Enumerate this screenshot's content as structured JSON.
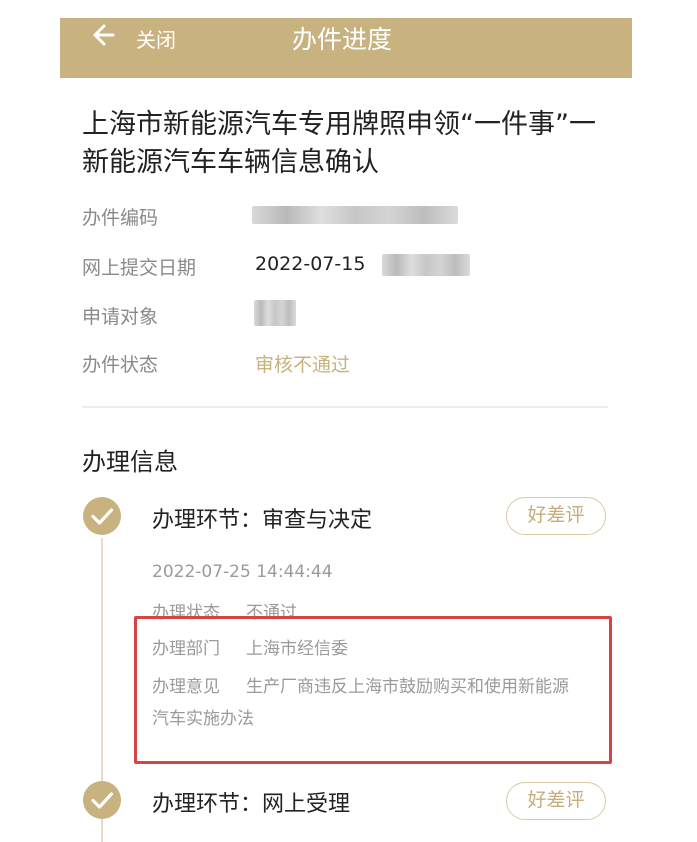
{
  "header": {
    "close_label": "关闭",
    "title": "办件进度"
  },
  "case": {
    "title": "上海市新能源汽车专用牌照申领“一件事”一新能源汽车车辆信息确认",
    "fields": {
      "code_label": "办件编码",
      "date_label": "网上提交日期",
      "date_value": "2022-07-15",
      "applicant_label": "申请对象",
      "status_label": "办件状态",
      "status_value": "审核不通过"
    }
  },
  "process": {
    "section_title": "办理信息",
    "steps": [
      {
        "title": "办理环节：审查与决定",
        "rate_label": "好差评",
        "datetime": "2022-07-25 14:44:44",
        "status_label": "办理状态",
        "status_value": "不通过",
        "dept_label": "办理部门",
        "dept_value": "上海市经信委",
        "opinion_label": "办理意见",
        "opinion_value_line1": "生产厂商违反上海市鼓励购买和使用新能源",
        "opinion_value_line2": "汽车实施办法"
      },
      {
        "title": "办理环节：网上受理",
        "rate_label": "好差评"
      }
    ]
  },
  "colors": {
    "accent": "#c8b27f",
    "highlight": "#d64444"
  },
  "icons": [
    "back-arrow-icon",
    "check-circle-icon"
  ]
}
